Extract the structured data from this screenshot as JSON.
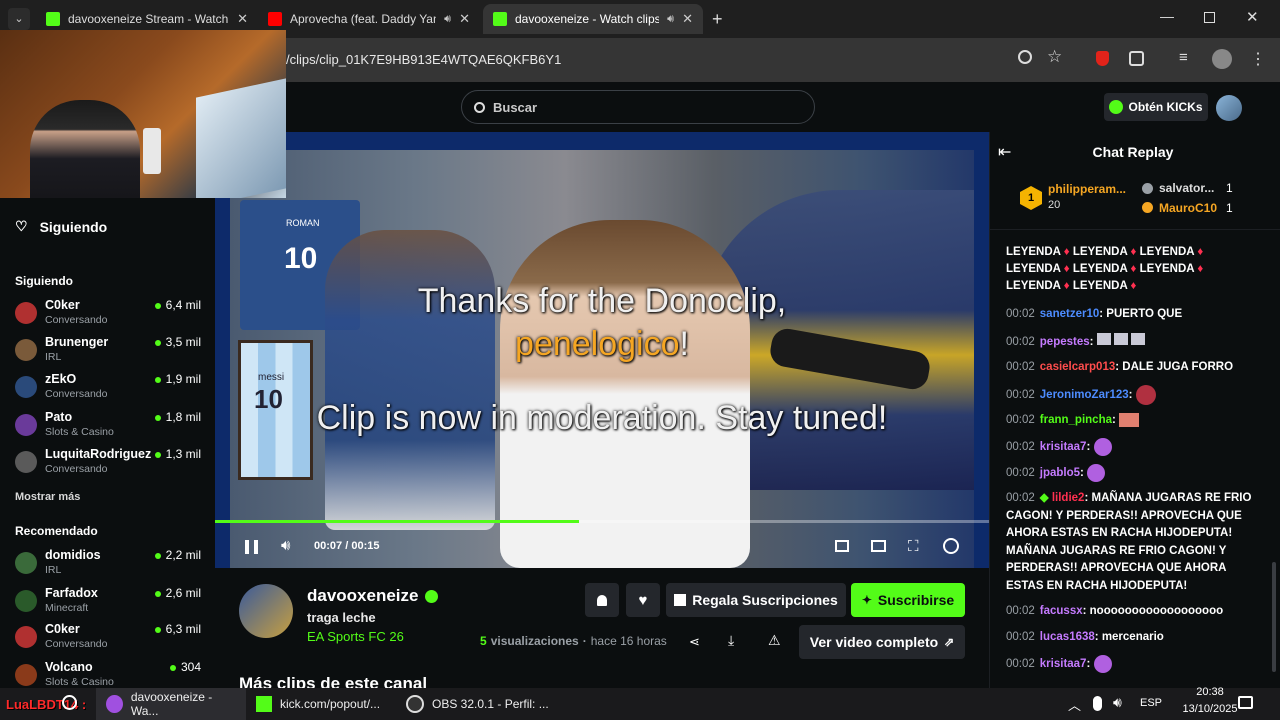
{
  "browser": {
    "tabs": [
      {
        "title": "davooxeneize Stream - Watch Live",
        "fav_color": "#53fc18",
        "active": false
      },
      {
        "title": "Aprovecha (feat. Daddy Yankee)",
        "fav_color": "#ff0000",
        "active": false
      },
      {
        "title": "davooxeneize - Watch clips",
        "fav_color": "#53fc18",
        "active": true
      }
    ],
    "url": "/clips/clip_01K7E9HB913E4WTQAE6QKFB6Y1"
  },
  "header": {
    "search_placeholder": "Buscar",
    "get_kicks": "Obtén KICKs"
  },
  "sidebar": {
    "following_item": "Siguiendo",
    "section_following": "Siguiendo",
    "following": [
      {
        "name": "C0ker",
        "category": "Conversando",
        "viewers": "6,4 mil",
        "color": "#b03030"
      },
      {
        "name": "Brunenger",
        "category": "IRL",
        "viewers": "3,5 mil",
        "color": "#7a5a3a"
      },
      {
        "name": "zEkO",
        "category": "Conversando",
        "viewers": "1,9 mil",
        "color": "#2a4a7a"
      },
      {
        "name": "Pato",
        "category": "Slots & Casino",
        "viewers": "1,8 mil",
        "color": "#6a3a9a"
      },
      {
        "name": "LuquitaRodriguez",
        "category": "Conversando",
        "viewers": "1,3 mil",
        "color": "#5a5a5a"
      }
    ],
    "show_more": "Mostrar más",
    "section_recommended": "Recomendado",
    "recommended": [
      {
        "name": "domidios",
        "category": "IRL",
        "viewers": "2,2 mil",
        "color": "#3a6a3a"
      },
      {
        "name": "Farfadox",
        "category": "Minecraft",
        "viewers": "2,6 mil",
        "color": "#2a5a2a"
      },
      {
        "name": "C0ker",
        "category": "Conversando",
        "viewers": "6,3 mil",
        "color": "#b03030"
      },
      {
        "name": "Volcano",
        "category": "Slots & Casino",
        "viewers": "304",
        "color": "#8a3a1a"
      }
    ]
  },
  "video": {
    "overlay_line1": "Thanks for the Donoclip,",
    "overlay_user": "penelogico",
    "overlay_excl": "!",
    "overlay_line2": "Clip is now in moderation. Stay tuned!",
    "time_current": "00:07",
    "time_sep": "/",
    "time_total": "00:15",
    "progress": 0.47,
    "jersey_number": "10",
    "jersey_name": "ROMAN",
    "jersey2_name": "messi",
    "jersey2_number": "10"
  },
  "channel": {
    "name": "davooxeneize",
    "title": "traga leche",
    "category": "EA Sports FC 26",
    "gift_subs": "Regala Suscripciones",
    "subscribe": "Suscribirse",
    "views_count": "5",
    "views_label": "visualizaciones",
    "age": "hace 16 horas",
    "full_video": "Ver video completo",
    "more_label": "Más clips de este canal"
  },
  "chat": {
    "title": "Chat Replay",
    "leaderboard": [
      {
        "rank": "1",
        "name": "philipperam...",
        "amount": "20"
      },
      {
        "name": "salvator...",
        "amount": "1"
      },
      {
        "name": "MauroC10",
        "amount": "1"
      }
    ],
    "leyenda_word": "LEYENDA",
    "messages": [
      {
        "time": "00:02",
        "user": "sanetzer10",
        "color": "#4d8cff",
        "text": "PUERTO QUE"
      },
      {
        "time": "00:02",
        "user": "pepestes",
        "color": "#c57bff",
        "text": ""
      },
      {
        "time": "00:02",
        "user": "casielcarp013",
        "color": "#ff4d4d",
        "text": "DALE JUGA FORRO"
      },
      {
        "time": "00:02",
        "user": "JeronimoZar123",
        "color": "#4d8cff",
        "text": ""
      },
      {
        "time": "00:02",
        "user": "frann_pincha",
        "color": "#53fc18",
        "text": ""
      },
      {
        "time": "00:02",
        "user": "krisitaa7",
        "color": "#c57bff",
        "text": ""
      },
      {
        "time": "00:02",
        "user": "jpablo5",
        "color": "#c57bff",
        "text": ""
      },
      {
        "time": "00:02",
        "user": "lildie2",
        "color": "#ff3050",
        "text": "MAÑANA JUGARAS RE FRIO CAGON! Y PERDERAS!! APROVECHA QUE AHORA ESTAS EN RACHA HIJODEPUTA! MAÑANA JUGARAS RE FRIO CAGON! Y PERDERAS!! APROVECHA QUE AHORA ESTAS EN RACHA HIJODEPUTA!"
      },
      {
        "time": "00:02",
        "user": "facussx",
        "color": "#c57bff",
        "text": "noooooooooooooooooo"
      },
      {
        "time": "00:02",
        "user": "lucas1638",
        "color": "#c57bff",
        "text": "mercenario"
      },
      {
        "time": "00:02",
        "user": "krisitaa7",
        "color": "#c57bff",
        "text": ""
      }
    ]
  },
  "taskbar": {
    "overlay_user": "LuaLBDT14 :",
    "items": [
      "davooxeneize - Wa...",
      "kick.com/popout/...",
      "OBS 32.0.1 - Perfil: ..."
    ],
    "lang": "ESP",
    "time": "20:38",
    "date": "13/10/2025"
  },
  "colors": {
    "accent": "#53fc18",
    "bg": "#0b0e0f"
  }
}
